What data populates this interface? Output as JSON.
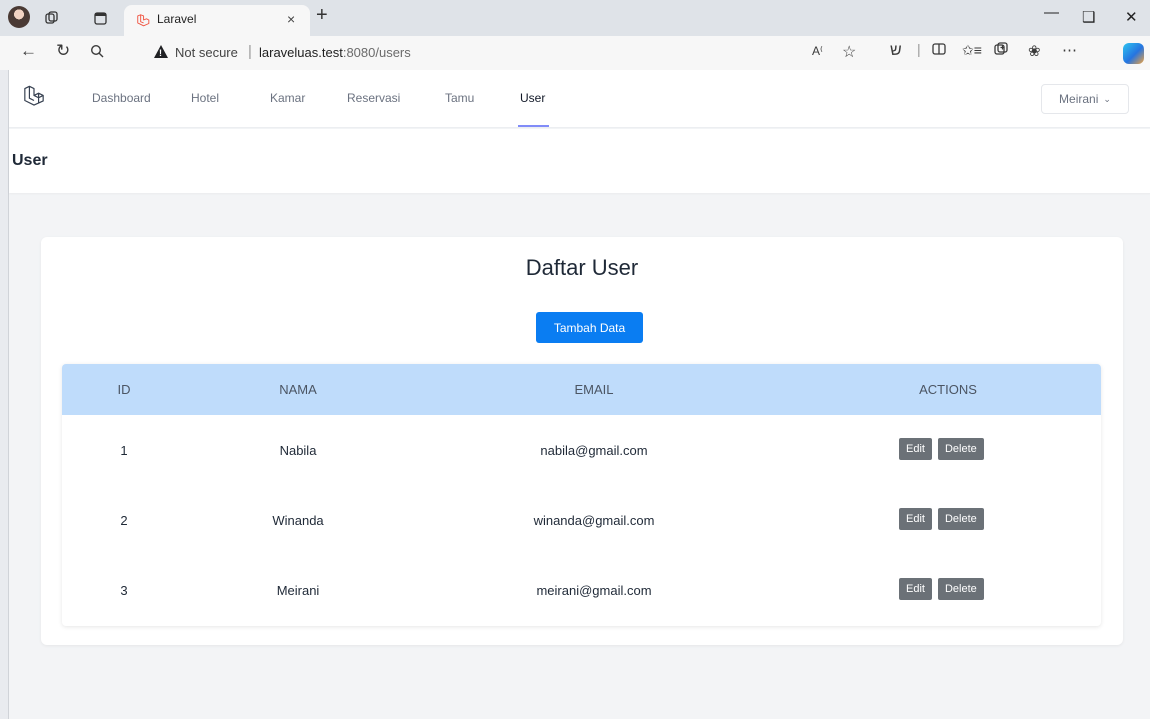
{
  "browser": {
    "tab_title": "Laravel",
    "tab_close": "×",
    "new_tab": "+",
    "security_label": "Not secure",
    "url_host": "laraveluas.test",
    "url_path": ":8080/users",
    "separator": "|"
  },
  "nav": {
    "items": [
      {
        "label": "Dashboard"
      },
      {
        "label": "Hotel"
      },
      {
        "label": "Kamar"
      },
      {
        "label": "Reservasi"
      },
      {
        "label": "Tamu"
      },
      {
        "label": "User"
      }
    ],
    "active": "User",
    "user_name": "Meirani"
  },
  "header": {
    "title": "User"
  },
  "main": {
    "title": "Daftar User",
    "add_button": "Tambah Data",
    "columns": [
      "ID",
      "NAMA",
      "EMAIL",
      "ACTIONS"
    ],
    "rows": [
      {
        "id": "1",
        "nama": "Nabila",
        "email": "nabila@gmail.com"
      },
      {
        "id": "2",
        "nama": "Winanda",
        "email": "winanda@gmail.com"
      },
      {
        "id": "3",
        "nama": "Meirani",
        "email": "meirani@gmail.com"
      }
    ],
    "edit_label": "Edit",
    "delete_label": "Delete"
  },
  "colors": {
    "primary_button": "#0a7df2",
    "table_header": "#bfdcfb",
    "action_button": "#6b7177",
    "active_underline": "#818cf8"
  },
  "icons": [
    "profile-avatar-icon",
    "workspaces-icon",
    "tab-actions-icon",
    "laravel-logo-icon",
    "back-icon",
    "refresh-icon",
    "search-icon",
    "warning-icon",
    "read-aloud-icon",
    "favorite-icon",
    "extensions-icon",
    "split-screen-icon",
    "favorites-icon",
    "collections-icon",
    "performance-icon",
    "more-icon",
    "copilot-icon",
    "minimize-icon",
    "restore-icon",
    "close-icon"
  ]
}
